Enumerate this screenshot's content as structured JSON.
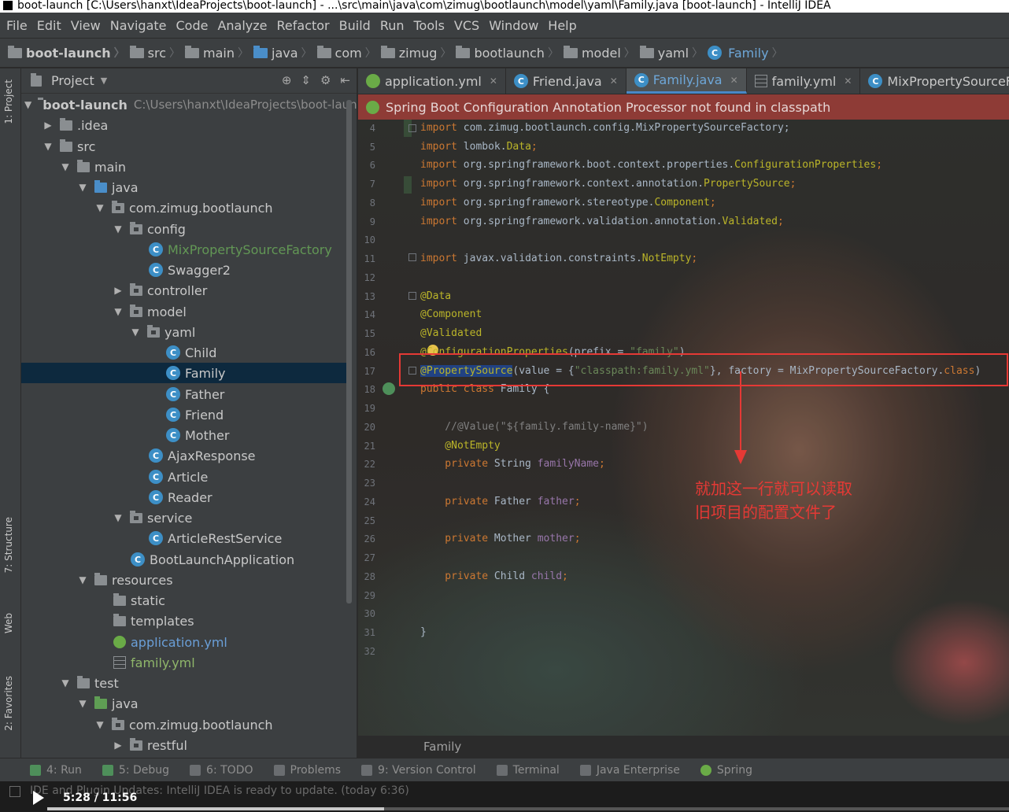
{
  "title": "boot-launch [C:\\Users\\hanxt\\IdeaProjects\\boot-launch] - ...\\src\\main\\java\\com\\zimug\\bootlaunch\\model\\yaml\\Family.java [boot-launch] - IntelliJ IDEA",
  "menu": [
    "File",
    "Edit",
    "View",
    "Navigate",
    "Code",
    "Analyze",
    "Refactor",
    "Build",
    "Run",
    "Tools",
    "VCS",
    "Window",
    "Help"
  ],
  "breadcrumb": [
    "boot-launch",
    "src",
    "main",
    "java",
    "com",
    "zimug",
    "bootlaunch",
    "model",
    "yaml",
    "Family"
  ],
  "left_stripe": {
    "project": "1: Project",
    "structure": "7: Structure",
    "web": "Web",
    "favorites": "2: Favorites"
  },
  "project_panel": {
    "title": "Project",
    "tree": [
      {
        "label": "boot-launch",
        "path": "C:\\Users\\hanxt\\IdeaProjects\\boot-laun"
      },
      {
        "label": ".idea"
      },
      {
        "label": "src"
      },
      {
        "label": "main"
      },
      {
        "label": "java"
      },
      {
        "label": "com.zimug.bootlaunch"
      },
      {
        "label": "config"
      },
      {
        "label": "MixPropertySourceFactory"
      },
      {
        "label": "Swagger2"
      },
      {
        "label": "controller"
      },
      {
        "label": "model"
      },
      {
        "label": "yaml"
      },
      {
        "label": "Child"
      },
      {
        "label": "Family"
      },
      {
        "label": "Father"
      },
      {
        "label": "Friend"
      },
      {
        "label": "Mother"
      },
      {
        "label": "AjaxResponse"
      },
      {
        "label": "Article"
      },
      {
        "label": "Reader"
      },
      {
        "label": "service"
      },
      {
        "label": "ArticleRestService"
      },
      {
        "label": "BootLaunchApplication"
      },
      {
        "label": "resources"
      },
      {
        "label": "static"
      },
      {
        "label": "templates"
      },
      {
        "label": "application.yml"
      },
      {
        "label": "family.yml"
      },
      {
        "label": "test"
      },
      {
        "label": "java"
      },
      {
        "label": "com.zimug.bootlaunch"
      },
      {
        "label": "restful"
      }
    ]
  },
  "tabs": [
    "application.yml",
    "Friend.java",
    "Family.java",
    "family.yml",
    "MixPropertySourceFactory.ja"
  ],
  "warning": "Spring Boot Configuration Annotation Processor not found in classpath",
  "line_numbers": [
    "4",
    "5",
    "6",
    "7",
    "8",
    "9",
    "10",
    "11",
    "12",
    "13",
    "14",
    "15",
    "16",
    "17",
    "18",
    "19",
    "20",
    "21",
    "22",
    "23",
    "24",
    "25",
    "26",
    "27",
    "28",
    "29",
    "30",
    "31",
    "32"
  ],
  "code": {
    "l4a": "import ",
    "l4b": "com.zimug.bootlaunch.config.MixPropertySourceFactory;",
    "l5a": "import ",
    "l5b": "lombok.",
    "l5c": "Data",
    "l5d": ";",
    "l6a": "import ",
    "l6b": "org.springframework.boot.context.properties.",
    "l6c": "ConfigurationProperties",
    "l6d": ";",
    "l7a": "import ",
    "l7b": "org.springframework.context.annotation.",
    "l7c": "PropertySource",
    "l7d": ";",
    "l8a": "import ",
    "l8b": "org.springframework.stereotype.",
    "l8c": "Component",
    "l8d": ";",
    "l9a": "import ",
    "l9b": "org.springframework.validation.annotation.",
    "l9c": "Validated",
    "l9d": ";",
    "l11a": "import ",
    "l11b": "javax.validation.constraints.",
    "l11c": "NotEmpty",
    "l11d": ";",
    "l13": "@Data",
    "l14": "@Component",
    "l15": "@Validated",
    "l16a": "@ConfigurationProperties",
    "l16b": "(prefix = ",
    "l16c": "\"family\"",
    "l16d": ")",
    "l17a": "@PropertySource",
    "l17b": "(value = {",
    "l17c": "\"classpath:family.yml\"",
    "l17d": "}, factory = MixPropertySourceFactory.",
    "l17e": "class",
    "l17f": ")",
    "l18a": "public class ",
    "l18b": "Family {",
    "l20": "    //@Value(\"${family.family-name}\")",
    "l21": "    @NotEmpty",
    "l22a": "    private ",
    "l22b": "String ",
    "l22c": "familyName",
    "l22d": ";",
    "l24a": "    private ",
    "l24b": "Father ",
    "l24c": "father",
    "l24d": ";",
    "l26a": "    private ",
    "l26b": "Mother ",
    "l26c": "mother",
    "l26d": ";",
    "l28a": "    private ",
    "l28b": "Child ",
    "l28c": "child",
    "l28d": ";",
    "l31": "}"
  },
  "annotation_note": [
    "就加这一行就可以读取",
    "旧项目的配置文件了"
  ],
  "editor_footer": "Family",
  "bottom_tools": [
    "4: Run",
    "5: Debug",
    "6: TODO",
    "Problems",
    "9: Version Control",
    "Terminal",
    "Java Enterprise",
    "Spring"
  ],
  "status_message": "IDE and Plugin Updates: IntelliJ IDEA is ready to update. (today 6:36)",
  "video": {
    "time": "5:28 / 11:56",
    "progress": 0.35
  },
  "colors": {
    "accent": "#4a88c7",
    "warning_bg": "#8e3b36",
    "annotation_red": "#e53935"
  }
}
